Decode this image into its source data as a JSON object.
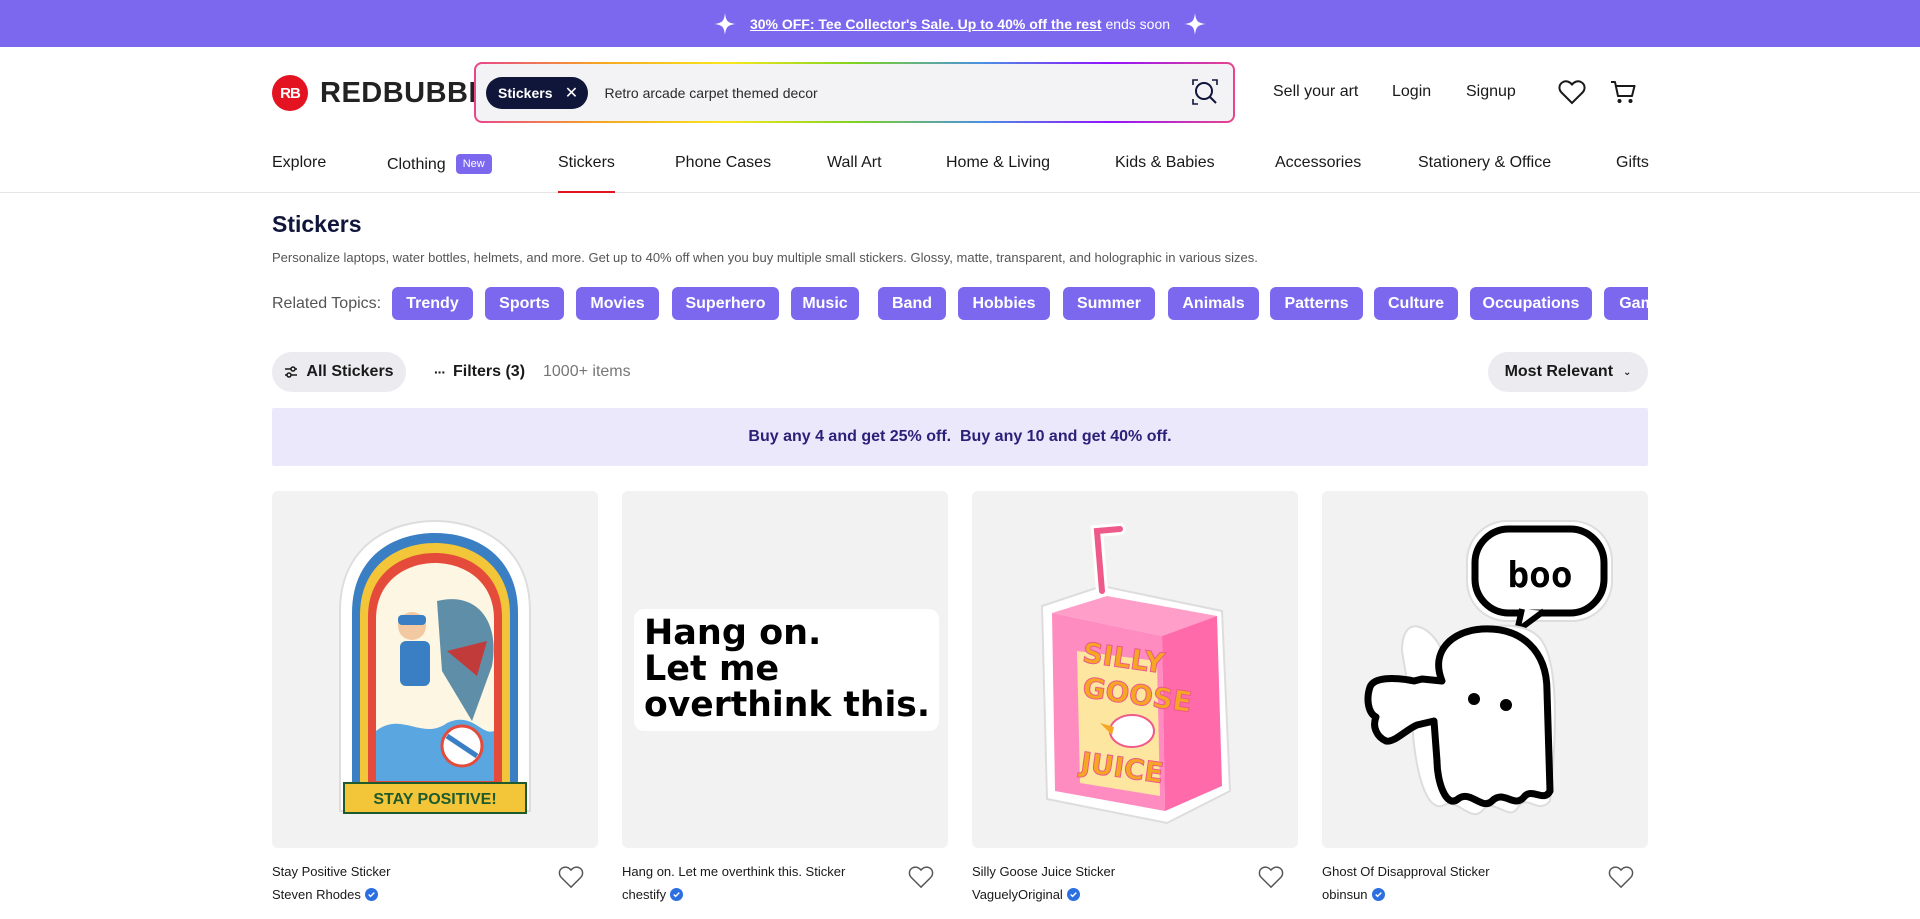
{
  "promo": {
    "link_text": "30% OFF: Tee Collector's Sale. Up to 40% off the rest",
    "suffix": "ends soon",
    "color": "#7B68EE"
  },
  "header": {
    "logo_text": "REDBUBBLE",
    "logo_mark": "RB",
    "search": {
      "chip": "Stickers",
      "query": "Retro arcade carpet themed decor"
    },
    "links": {
      "sell": "Sell your art",
      "login": "Login",
      "signup": "Signup"
    }
  },
  "nav": {
    "items": [
      "Explore",
      "Clothing",
      "Stickers",
      "Phone Cases",
      "Wall Art",
      "Home & Living",
      "Kids & Babies",
      "Accessories",
      "Stationery & Office",
      "Gifts"
    ],
    "new_badge": "New",
    "active": "Stickers"
  },
  "page": {
    "title": "Stickers",
    "description": "Personalize laptops, water bottles, helmets, and more. Get up to 40% off when you buy multiple small stickers. Glossy, matte, transparent, and holographic in various sizes.",
    "related_label": "Related Topics:",
    "topics": [
      "Trendy",
      "Sports",
      "Movies",
      "Superhero",
      "Music",
      "Band",
      "Hobbies",
      "Summer",
      "Animals",
      "Patterns",
      "Culture",
      "Occupations",
      "Gaming"
    ]
  },
  "filters": {
    "all_label": "All Stickers",
    "filters_label": "Filters (3)",
    "count": "1000+ items",
    "sort": "Most Relevant"
  },
  "deal": "Buy any 4 and get 25% off.  Buy any 10 and get 40% off.",
  "products": [
    {
      "title": "Stay Positive Sticker",
      "artist": "Steven Rhodes",
      "verified": true
    },
    {
      "title": "Hang on. Let me overthink this. Sticker",
      "artist": "chestify",
      "verified": true,
      "art_lines": [
        "Hang on.",
        "Let me",
        "overthink this."
      ]
    },
    {
      "title": "Silly Goose Juice Sticker",
      "artist": "VaguelyOriginal",
      "verified": true,
      "art_words": [
        "SILLY",
        "GOOSE",
        "JUICE"
      ]
    },
    {
      "title": "Ghost Of Disapproval Sticker",
      "artist": "obinsun",
      "verified": true,
      "art_word": "boo"
    }
  ],
  "sticker1_banner": "STAY POSITIVE!"
}
